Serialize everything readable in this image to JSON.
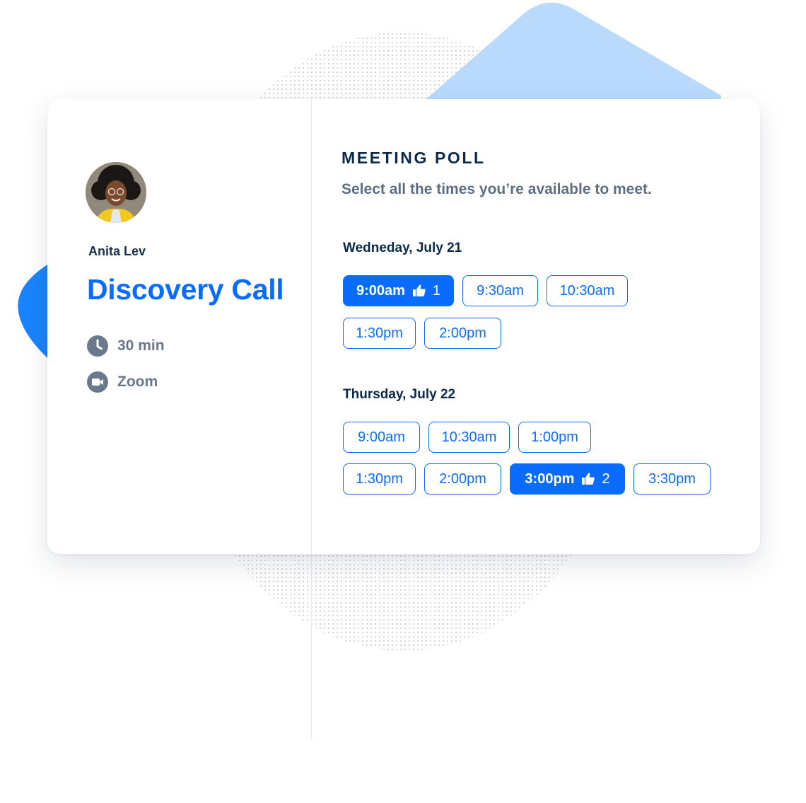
{
  "colors": {
    "accent": "#0a6cff",
    "heading": "#0b2a4a",
    "muted": "#6a7788",
    "blob": "#b9dafc"
  },
  "host": {
    "name": "Anita Lev",
    "avatar_icon": "person-avatar"
  },
  "event": {
    "title": "Discovery Call",
    "duration": "30 min",
    "location": "Zoom",
    "duration_icon": "clock-icon",
    "location_icon": "video-camera-icon"
  },
  "poll": {
    "heading": "MEETING POLL",
    "subheading": "Select all the times you’re available to meet.",
    "days": [
      {
        "label": "Wedneday, July 21",
        "slots": [
          {
            "time": "9:00am",
            "selected": true,
            "votes": "1"
          },
          {
            "time": "9:30am",
            "selected": false
          },
          {
            "time": "10:30am",
            "selected": false
          },
          {
            "time": "1:30pm",
            "selected": false
          },
          {
            "time": "2:00pm",
            "selected": false
          }
        ]
      },
      {
        "label": "Thursday, July 22",
        "slots": [
          {
            "time": "9:00am",
            "selected": false
          },
          {
            "time": "10:30am",
            "selected": false
          },
          {
            "time": "1:00pm",
            "selected": false
          },
          {
            "time": "1:30pm",
            "selected": false
          },
          {
            "time": "2:00pm",
            "selected": false
          },
          {
            "time": "3:00pm",
            "selected": true,
            "votes": "2"
          },
          {
            "time": "3:30pm",
            "selected": false
          }
        ]
      }
    ]
  }
}
